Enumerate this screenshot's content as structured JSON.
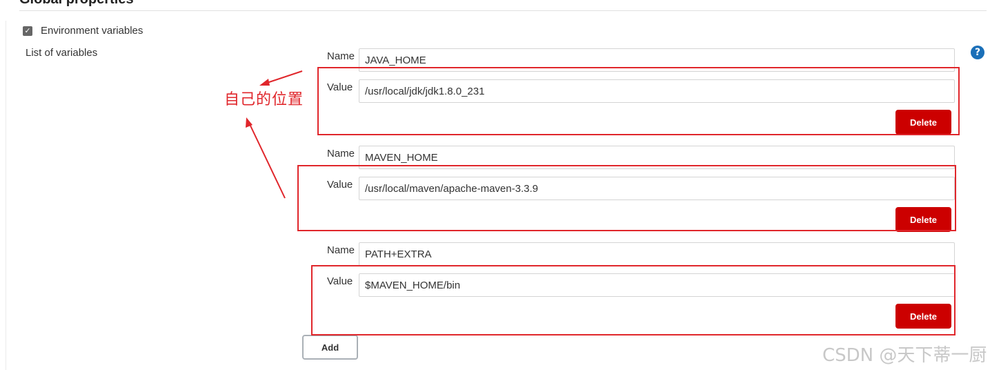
{
  "section": {
    "title": "Global properties"
  },
  "env": {
    "checkbox_label": "Environment variables",
    "checked": true,
    "list_label": "List of variables"
  },
  "help_icon": {
    "glyph": "?",
    "icon": "help-icon"
  },
  "labels": {
    "name": "Name",
    "value": "Value"
  },
  "variables": [
    {
      "name": "JAVA_HOME",
      "value": "/usr/local/jdk/jdk1.8.0_231",
      "delete_label": "Delete"
    },
    {
      "name": "MAVEN_HOME",
      "value": "/usr/local/maven/apache-maven-3.3.9",
      "delete_label": "Delete"
    },
    {
      "name": "PATH+EXTRA",
      "value": "$MAVEN_HOME/bin",
      "delete_label": "Delete"
    }
  ],
  "add_label": "Add",
  "annotation": {
    "text": "自己的位置",
    "color": "#e0262b"
  },
  "watermark": "CSDN @天下蒂一厨",
  "colors": {
    "delete": "#cc0000",
    "help": "#1a6fb8",
    "annotation": "#e0262b"
  }
}
